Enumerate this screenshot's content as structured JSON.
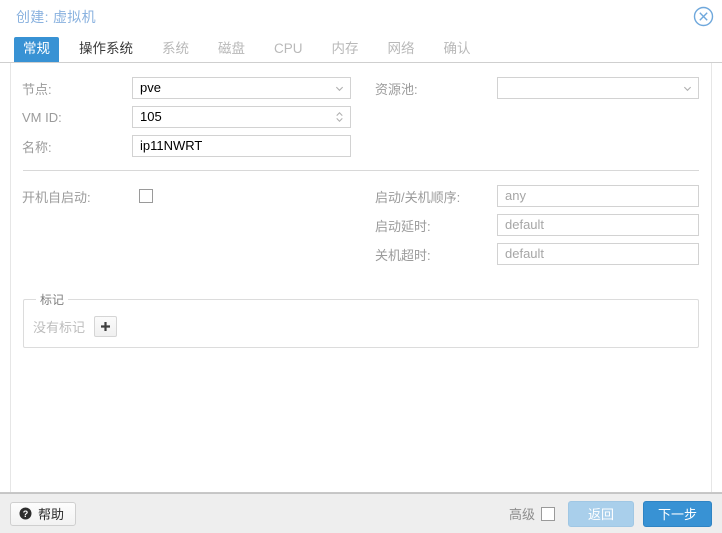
{
  "window": {
    "title": "创建: 虚拟机",
    "close_icon": "close-circle-icon"
  },
  "tabs": [
    {
      "label": "常规",
      "state": "active"
    },
    {
      "label": "操作系统",
      "state": "enabled"
    },
    {
      "label": "系统",
      "state": "disabled"
    },
    {
      "label": "磁盘",
      "state": "disabled"
    },
    {
      "label": "CPU",
      "state": "disabled"
    },
    {
      "label": "内存",
      "state": "disabled"
    },
    {
      "label": "网络",
      "state": "disabled"
    },
    {
      "label": "确认",
      "state": "disabled"
    }
  ],
  "form": {
    "node": {
      "label": "节点:",
      "value": "pve",
      "icon": "chevron-down-icon"
    },
    "vmid": {
      "label": "VM ID:",
      "value": "105",
      "icon": "spinner-updown-icon"
    },
    "name": {
      "label": "名称:",
      "value": "ip11NWRT"
    },
    "resource_pool": {
      "label": "资源池:",
      "value": "",
      "icon": "chevron-down-icon"
    },
    "start_at_boot": {
      "label": "开机自启动:",
      "checked": false
    },
    "start_order": {
      "label": "启动/关机顺序:",
      "placeholder": "any"
    },
    "startup_delay": {
      "label": "启动延时:",
      "placeholder": "default"
    },
    "shutdown_timeout": {
      "label": "关机超时:",
      "placeholder": "default"
    },
    "tags": {
      "legend": "标记",
      "empty_text": "没有标记",
      "add_icon": "plus-icon"
    }
  },
  "footer": {
    "help_label": "帮助",
    "help_icon": "question-circle-icon",
    "advanced_label": "高级",
    "advanced_checked": false,
    "back_label": "返回",
    "next_label": "下一步"
  },
  "colors": {
    "accent": "#3892d4",
    "title": "#8ab2df",
    "back_button": "#a9cfeb",
    "label_text": "#9b9b9b",
    "disabled_tab": "#b9b9b9"
  }
}
